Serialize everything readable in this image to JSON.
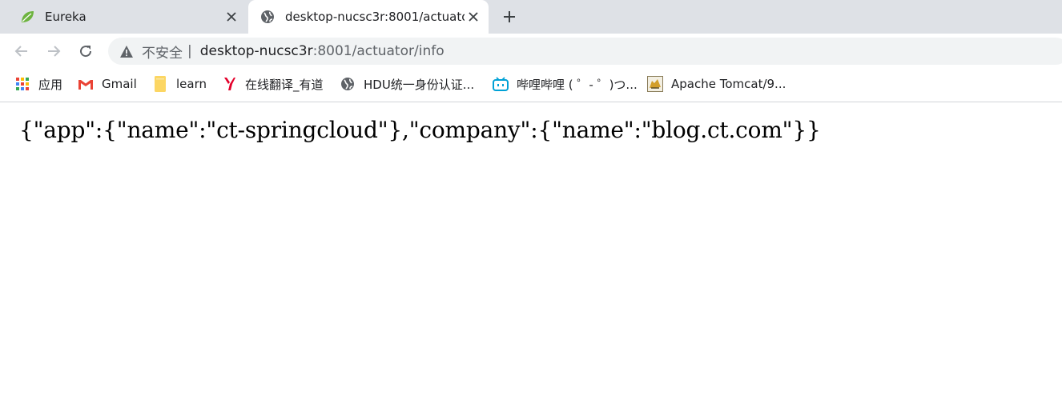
{
  "tabs": [
    {
      "title": "Eureka",
      "favicon": "spring-leaf-icon"
    },
    {
      "title": "desktop-nucsc3r:8001/actuator/info",
      "favicon": "globe-icon"
    }
  ],
  "new_tab_symbol": "+",
  "address_bar": {
    "security_label": "不安全",
    "separator": "|",
    "host": "desktop-nucsc3r",
    "path": ":8001/actuator/info"
  },
  "bookmarks": [
    {
      "label": "应用",
      "icon": "apps-grid-icon"
    },
    {
      "label": "Gmail",
      "icon": "gmail-icon"
    },
    {
      "label": "learn",
      "icon": "folder-icon"
    },
    {
      "label": "在线翻译_有道",
      "icon": "youdao-icon"
    },
    {
      "label": "HDU统一身份认证...",
      "icon": "globe-icon"
    },
    {
      "label": "哔哩哔哩 ( ゜- ゜)つ...",
      "icon": "bilibili-icon"
    },
    {
      "label": "Apache Tomcat/9...",
      "icon": "tomcat-icon"
    }
  ],
  "page": {
    "json_text": "{\"app\":{\"name\":\"ct-springcloud\"},\"company\":{\"name\":\"blog.ct.com\"}}"
  },
  "colors": {
    "tabstrip": "#dee1e6",
    "omnibox": "#f1f3f4",
    "spring_green": "#6db33f",
    "gmail_red": "#ea4335",
    "folder_yellow": "#fcd663",
    "youdao_red": "#e4002b",
    "bilibili_blue": "#00a1d6"
  }
}
